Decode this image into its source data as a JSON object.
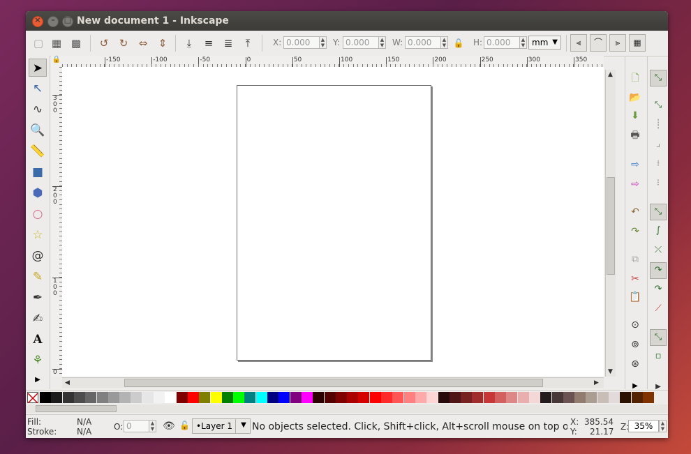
{
  "window": {
    "title": "New document 1 - Inkscape"
  },
  "toolbar": {
    "x_label": "X:",
    "x_value": "0.000",
    "y_label": "Y:",
    "y_value": "0.000",
    "w_label": "W:",
    "w_value": "0.000",
    "h_label": "H:",
    "h_value": "0.000",
    "unit": "mm"
  },
  "rulers": {
    "horizontal_ticks": [
      "-150",
      "-100",
      "-50",
      "0",
      "50",
      "100",
      "150",
      "200",
      "250",
      "300",
      "350"
    ],
    "vertical_ticks": [
      "3\n0\n0",
      "2\n0\n0",
      "1\n0\n0",
      "0"
    ]
  },
  "palette": {
    "colors": [
      "#000000",
      "#1a1a1a",
      "#333333",
      "#4d4d4d",
      "#666666",
      "#808080",
      "#999999",
      "#b3b3b3",
      "#cccccc",
      "#e6e6e6",
      "#f2f2f2",
      "#ffffff",
      "#800000",
      "#ff0000",
      "#808000",
      "#ffff00",
      "#008000",
      "#00ff00",
      "#008080",
      "#00ffff",
      "#000080",
      "#0000ff",
      "#800080",
      "#ff00ff",
      "#2b0000",
      "#550000",
      "#800000",
      "#aa0000",
      "#d40000",
      "#ff0000",
      "#ff2a2a",
      "#ff5555",
      "#ff8080",
      "#ffaaaa",
      "#ffd5d5",
      "#280b0b",
      "#501616",
      "#782121",
      "#a02c2c",
      "#c83737",
      "#d35f5f",
      "#de8787",
      "#e9afaf",
      "#f4d7d7",
      "#241c1c",
      "#483737",
      "#6c5353",
      "#917c6f",
      "#ac9d93",
      "#c8beb7",
      "#e3dbdb",
      "#2b1100",
      "#552200",
      "#803300"
    ]
  },
  "status": {
    "fill_label": "Fill:",
    "fill_value": "N/A",
    "stroke_label": "Stroke:",
    "stroke_value": "N/A",
    "opacity_label": "O:",
    "opacity_value": "0",
    "layer": "•Layer 1",
    "message": "No objects selected. Click, Shift+click, Alt+scroll mouse on top of...",
    "x_label": "X:",
    "x_value": "385.54",
    "y_label": "Y:",
    "y_value": "21.17",
    "z_label": "Z:",
    "zoom": "35%"
  }
}
